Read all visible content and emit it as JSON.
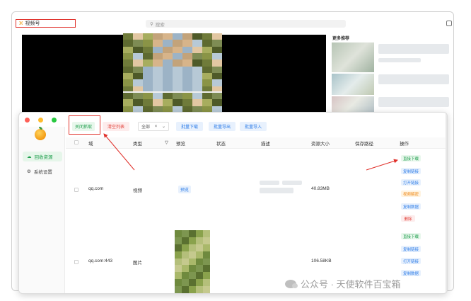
{
  "top_bar": {
    "channel_label": "视频号",
    "search_placeholder": "搜索"
  },
  "sidebar_right": {
    "more_title": "更多推荐"
  },
  "app": {
    "sidebar": {
      "items": [
        {
          "label": "回收资源",
          "active": true
        },
        {
          "label": "系统设置",
          "active": false
        }
      ]
    },
    "toolbar": {
      "close_capture": "关闭抓取",
      "clear_list": "清空列表",
      "filter_value": "全部",
      "batch_download": "批量下载",
      "batch_export": "批量导出",
      "batch_import": "批量导入"
    },
    "table": {
      "headers": [
        "域",
        "类型",
        "预览",
        "状态",
        "描述",
        "资源大小",
        "保存路径",
        "操作"
      ],
      "rows": [
        {
          "domain": "qq.com",
          "type": "视频",
          "preview": "预览",
          "size": "40.83MB",
          "actions": [
            "直接下载",
            "复制链接",
            "打开链接",
            "视频解密",
            "复制数据",
            "删除"
          ]
        },
        {
          "domain": "qq.com:443",
          "type": "图片",
          "preview": "",
          "size": "106.58KB",
          "actions": [
            "直接下载",
            "复制链接",
            "打开链接",
            "复制数据"
          ]
        }
      ]
    }
  },
  "watermark": "公众号 · 天使软件百宝箱",
  "colors": {
    "highlight_red": "#e0302a",
    "brand_green": "#1e9e4c",
    "link_blue": "#2f7ee8",
    "danger_red": "#e3433b",
    "warn_orange": "#ef8a1a"
  }
}
